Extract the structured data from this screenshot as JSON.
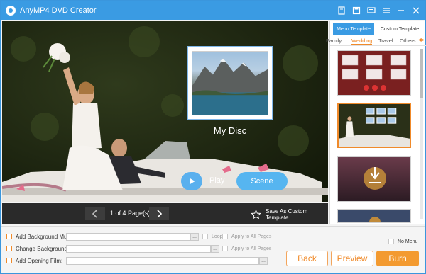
{
  "app": {
    "title": "AnyMP4 DVD Creator",
    "accent": "#3a9be3",
    "title_icons": [
      "document-icon",
      "save-icon",
      "feedback-icon",
      "menu-icon",
      "minimize-icon",
      "close-icon"
    ]
  },
  "preview": {
    "disc_title": "My Disc",
    "play_label": "Play",
    "scene_label": "Scene"
  },
  "pager": {
    "page_text": "1 of 4 Page(s)",
    "save_template_label": "Save As Custom Template"
  },
  "template_panel": {
    "tabs": [
      "Menu Template",
      "Custom Template"
    ],
    "active_tab": "Menu Template",
    "categories": [
      "Family",
      "Wedding",
      "Travel",
      "Others"
    ],
    "active_category": "Wedding",
    "selected_thumbnail": 2
  },
  "options": {
    "bg_music_label": "Add Background Music:",
    "loop_label": "Loop",
    "apply_all_label_1": "Apply to All Pages",
    "change_bg_label": "Change Background:",
    "apply_all_label_2": "Apply to All Pages",
    "opening_film_label": "Add Opening Film:",
    "browse_label": "...",
    "no_menu_label": "No Menu"
  },
  "actions": {
    "back": "Back",
    "preview": "Preview",
    "burn": "Burn",
    "burn_color": "#f39a30"
  }
}
